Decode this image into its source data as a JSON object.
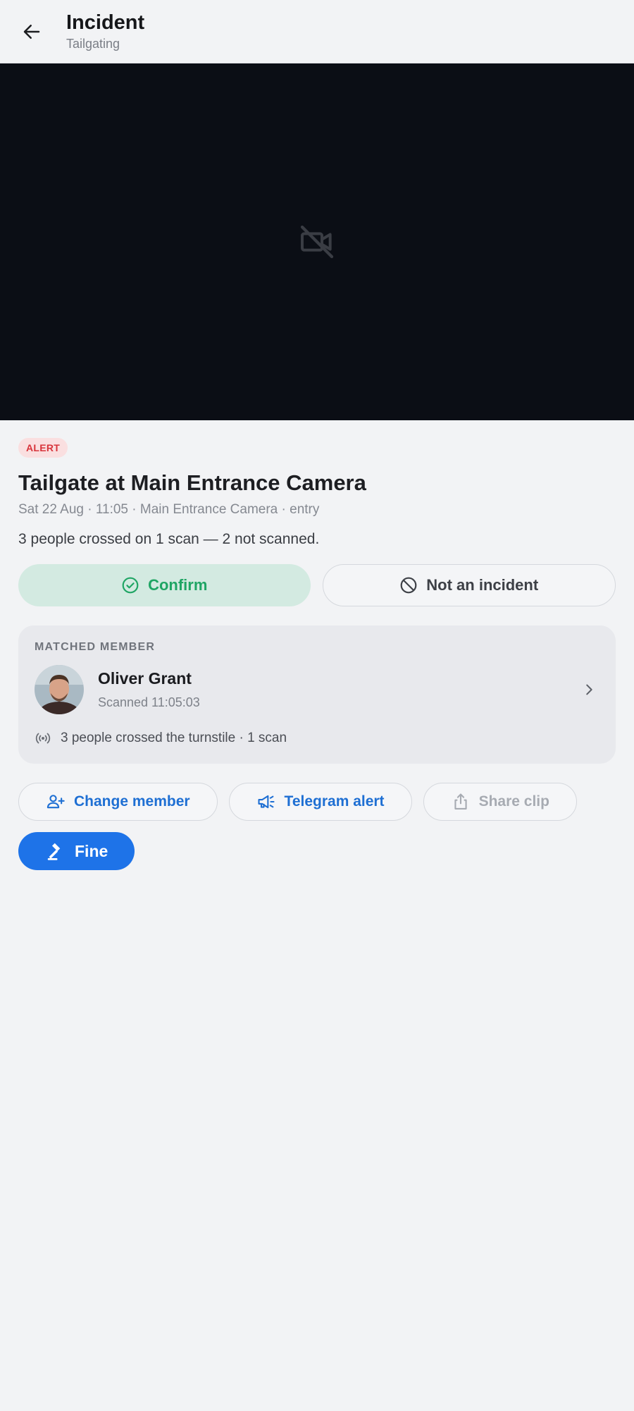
{
  "header": {
    "title": "Incident",
    "subtitle": "Tailgating"
  },
  "video": {
    "icon": "videocam-off-icon"
  },
  "incident": {
    "badge": "ALERT",
    "title": "Tailgate at Main Entrance Camera",
    "meta": "Sat 22 Aug · 11:05 · Main Entrance Camera · entry",
    "summary": "3 people crossed on 1 scan — 2 not scanned."
  },
  "actions": {
    "confirm_label": "Confirm",
    "not_incident_label": "Not an incident"
  },
  "member_card": {
    "section_label": "MATCHED MEMBER",
    "name": "Oliver Grant",
    "scanned": "Scanned 11:05:03",
    "crossed_text": "3 people crossed the turnstile · 1 scan"
  },
  "chips": {
    "change_member": "Change member",
    "telegram_alert": "Telegram alert",
    "share_clip": "Share clip",
    "fine": "Fine"
  },
  "colors": {
    "accent": "#1e73e8",
    "confirm_green": "#1fa564",
    "alert_red": "#d8343b"
  }
}
